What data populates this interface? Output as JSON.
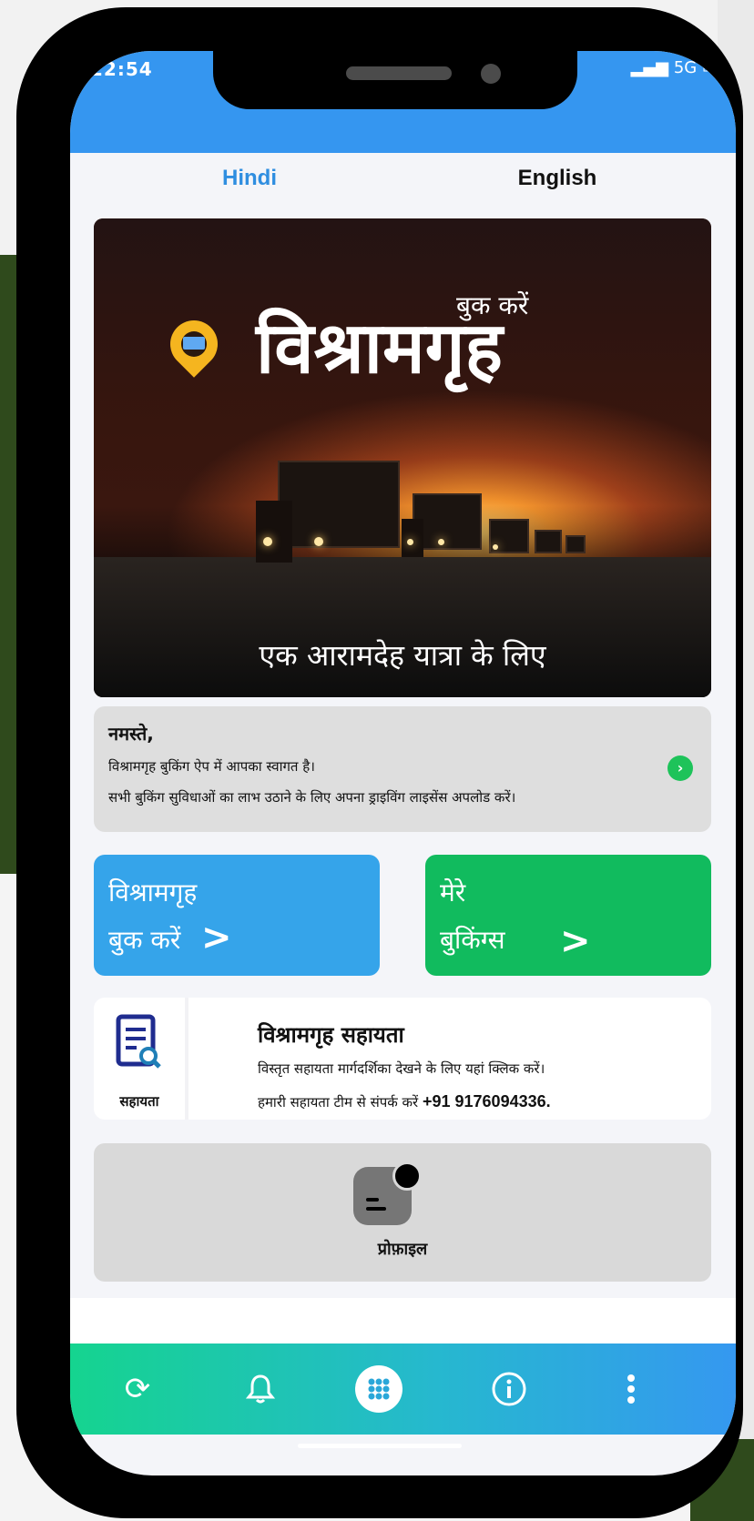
{
  "status": {
    "time": "22:54",
    "icons": "▂▄▆ 5G ▭"
  },
  "tabs": [
    {
      "label": "Hindi",
      "active": true
    },
    {
      "label": "English",
      "active": false
    }
  ],
  "banner": {
    "book_label": "बुक करें",
    "title": "विश्रामगृह",
    "subtitle": "एक आरामदेह यात्रा के लिए"
  },
  "welcome": {
    "title": "नमस्ते,",
    "line1": "विश्रामगृह बुकिंग ऐप में आपका स्वागत है।",
    "line2": "सभी बुकिंग सुविधाओं का लाभ उठाने के लिए अपना ड्राइविंग लाइसेंस अपलोड करें।"
  },
  "cards": {
    "book": {
      "line1": "विश्रामगृह",
      "line2": "बुक करें",
      "color": "#35a4ea"
    },
    "bookings": {
      "line1": "मेरे",
      "line2": "बुकिंग्स",
      "color": "#11bb5e"
    }
  },
  "help": {
    "caption": "सहायता",
    "title": "विश्रामगृह सहायता",
    "line1": "विस्तृत सहायता मार्गदर्शिका देखने के लिए यहां क्लिक करें।",
    "line2_prefix": "हमारी सहायता टीम से संपर्क करें",
    "phone": "+91 9176094336."
  },
  "profile": {
    "label": "प्रोफ़ाइल"
  },
  "navbar": {
    "items": [
      "refresh-icon",
      "bell-icon",
      "grid-menu-icon",
      "info-icon",
      "more-vertical-icon"
    ],
    "gradient": [
      "#15d48f",
      "#3598f0"
    ]
  }
}
